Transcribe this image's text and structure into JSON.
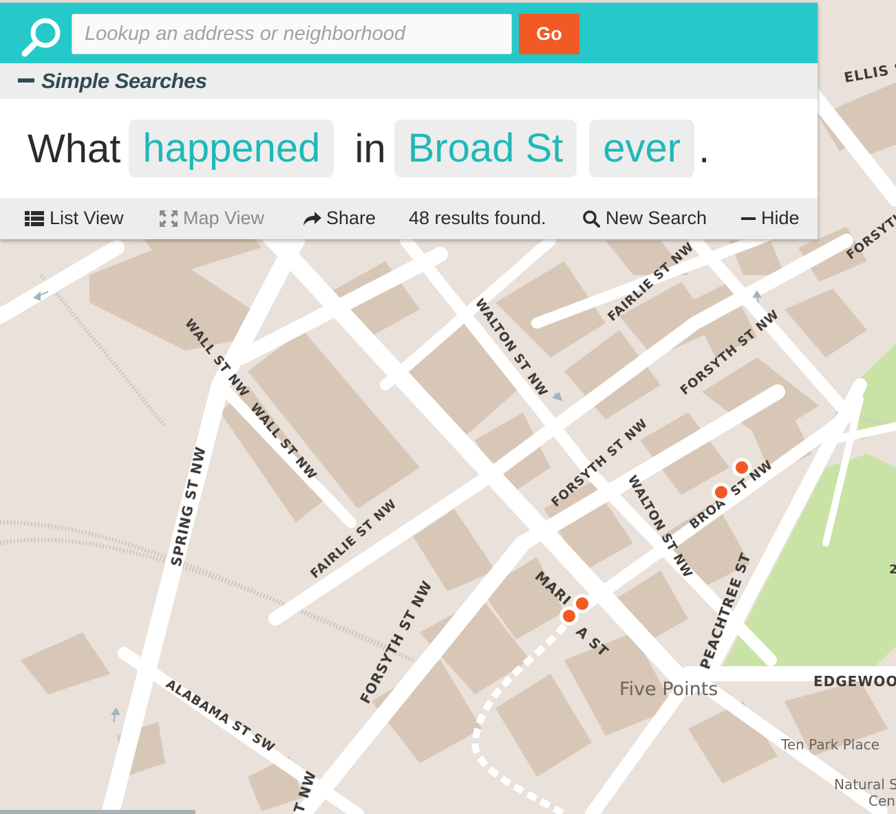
{
  "search": {
    "placeholder": "Lookup an address or neighborhood",
    "go_label": "Go",
    "icon": "search-icon"
  },
  "simple_searches": {
    "label": "Simple Searches",
    "icon": "minus-icon"
  },
  "sentence": {
    "what": "What",
    "event": "happened",
    "in": "in",
    "place": "Broad St",
    "time": "ever",
    "end": "."
  },
  "toolbar": {
    "list_view": "List View",
    "map_view": "Map View",
    "share": "Share",
    "results": "48 results found.",
    "new_search": "New Search",
    "hide": "Hide"
  },
  "map": {
    "streets": [
      "ELLIS S",
      "FAIRLIE ST NW",
      "WALTON ST NW",
      "FORSYTH ST NW",
      "WALL ST NW",
      "SPRING ST NW",
      "FORSYTH",
      "BROA",
      "ST NW",
      "MARI",
      "A ST",
      "PEACHTREE ST",
      "EDGEWOO",
      "ALABAMA ST SW",
      "T NW",
      "FORSYTH ST NW",
      "FAIRLIE ST NW",
      "WALTON ST NW",
      "FORSYTH ST NW",
      "2"
    ],
    "places": [
      "Five Points",
      "Ten Park Place",
      "Natural S",
      "Cen"
    ],
    "marker_count": 4,
    "colors": {
      "land": "#e9e1da",
      "building": "#d8c7b7",
      "road": "#ffffff",
      "park": "#c9e3a6",
      "marker": "#f15a24",
      "accent": "#26c9c9"
    }
  }
}
